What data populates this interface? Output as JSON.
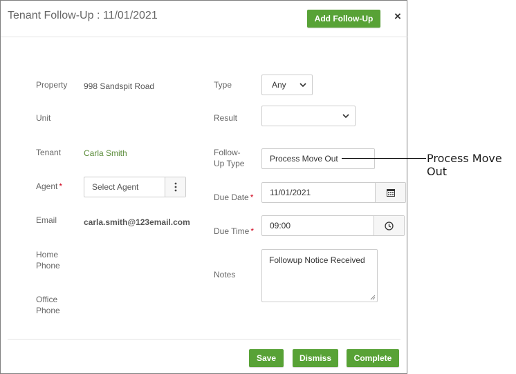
{
  "dialog": {
    "title": "Tenant Follow-Up : 11/01/2021",
    "add_button": "Add Follow-Up",
    "close_glyph": "×"
  },
  "left": {
    "property_label": "Property",
    "property_value": "998 Sandspit Road",
    "unit_label": "Unit",
    "tenant_label": "Tenant",
    "tenant_value": "Carla Smith",
    "agent_label": "Agent",
    "agent_placeholder": "Select Agent",
    "email_label": "Email",
    "email_value": "carla.smith@123email.com",
    "home_phone_label_1": "Home",
    "home_phone_label_2": "Phone",
    "office_phone_label_1": "Office",
    "office_phone_label_2": "Phone"
  },
  "right": {
    "type_label": "Type",
    "type_value": "Any",
    "result_label": "Result",
    "result_value": "",
    "followup_type_label_1": "Follow-",
    "followup_type_label_2": "Up Type",
    "followup_type_value": "Process Move Out",
    "due_date_label": "Due Date",
    "due_date_value": "11/01/2021",
    "due_time_label": "Due Time",
    "due_time_value": "09:00",
    "notes_label": "Notes",
    "notes_value": "Followup Notice Received"
  },
  "required_marker": "*",
  "footer": {
    "save": "Save",
    "dismiss": "Dismiss",
    "complete": "Complete"
  },
  "callout": {
    "text": "Process Move Out"
  },
  "colors": {
    "accent_green": "#58a236",
    "tenant_green": "#5b8c3a",
    "required_red": "#d0021b"
  },
  "icons": {
    "calendar": "calendar-icon",
    "clock": "clock-icon",
    "more": "vertical-dots-icon",
    "chevron": "chevron-down-icon",
    "resize": "resize-grip-icon"
  }
}
